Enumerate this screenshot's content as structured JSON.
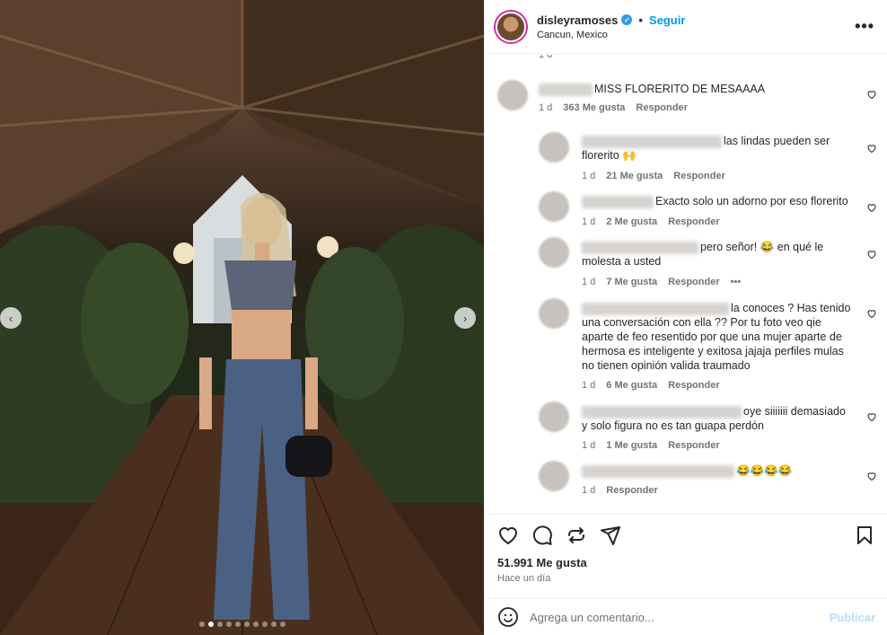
{
  "header": {
    "username": "disleyramoses",
    "follow_label": "Seguir",
    "location": "Cancun, Mexico",
    "more_label": "•••"
  },
  "photo": {
    "prev_label": "‹",
    "next_label": "›",
    "carousel_count": 10,
    "carousel_active": 1
  },
  "comments": {
    "top_time": "1 d",
    "main": {
      "text": "MISS FLORERITO DE MESAAAA",
      "time": "1 d",
      "likes": "363 Me gusta",
      "reply": "Responder"
    },
    "replies": [
      {
        "text_a": "las lindas pueden ser",
        "text_b": "florerito 🙌",
        "time": "1 d",
        "likes": "21 Me gusta",
        "reply": "Responder"
      },
      {
        "text_a": "Exacto solo un adorno por eso florerito",
        "time": "1 d",
        "likes": "2 Me gusta",
        "reply": "Responder"
      },
      {
        "text_a": "pero señor! 😂 en qué le",
        "text_b": "molesta a usted",
        "time": "1 d",
        "likes": "7 Me gusta",
        "reply": "Responder",
        "more": "•••"
      },
      {
        "text_a": "la conoces ? Has tenido",
        "text_lines": [
          "una conversación con ella ?? Por tu foto veo qie",
          "aparte de feo resentido por que una mujer aparte de",
          "hermosa es inteligente y exitosa jajaja perfiles mulas",
          "no tienen opinión valida traumado"
        ],
        "time": "1 d",
        "likes": "6 Me gusta",
        "reply": "Responder"
      },
      {
        "text_a": "oye siiiiiii demasiado",
        "text_b": "y solo figura no es tan guapa perdón",
        "time": "1 d",
        "likes": "1 Me gusta",
        "reply": "Responder"
      },
      {
        "text_a": "😂😂😂😂",
        "time": "1 d",
        "reply": "Responder"
      }
    ]
  },
  "footer": {
    "likes_count": "51.991 Me gusta",
    "when": "Hace un día",
    "comment_placeholder": "Agrega un comentario...",
    "post_label": "Publicar"
  },
  "colors": {
    "link_blue": "#0095f6",
    "muted": "#737373",
    "post_disabled": "#b2dffc"
  }
}
